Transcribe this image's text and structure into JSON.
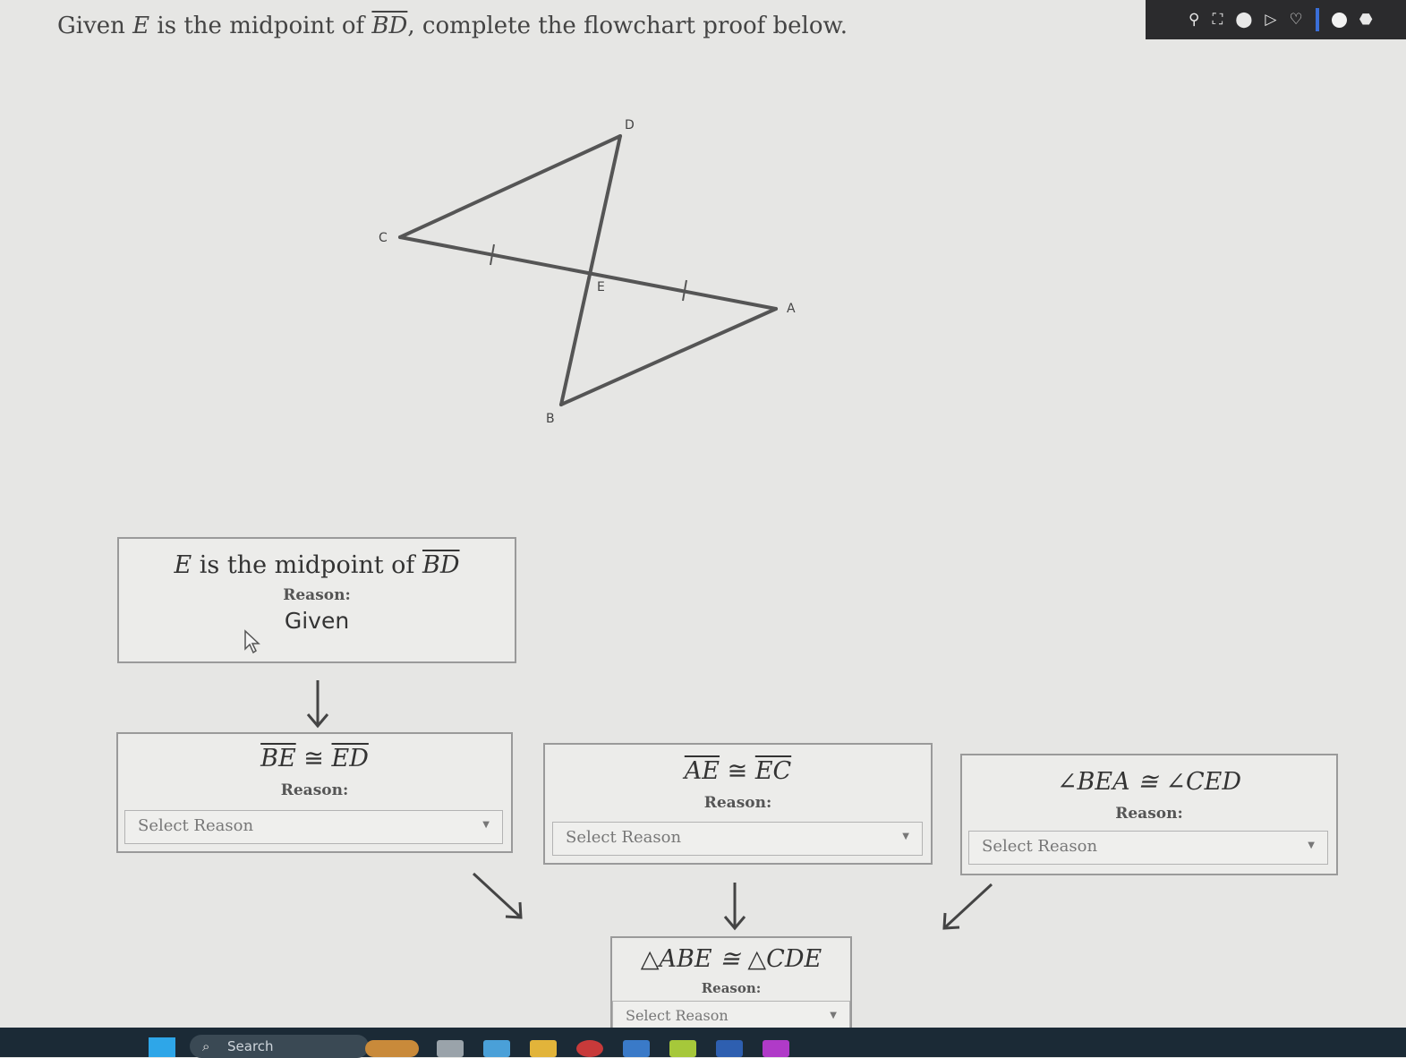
{
  "prompt": {
    "pre": "Given ",
    "var": "E",
    "mid": " is the midpoint of ",
    "seg": "BD",
    "post": ", complete the flowchart proof below."
  },
  "diagram_labels": {
    "D": "D",
    "C": "C",
    "E": "E",
    "A": "A",
    "B": "B"
  },
  "step1": {
    "var": "E",
    "text": " is the midpoint of ",
    "seg": "BD",
    "reason_label": "Reason:",
    "reason": "Given"
  },
  "step2": {
    "left": "BE",
    "cong": " ≅ ",
    "right": "ED",
    "reason_label": "Reason:",
    "select": "Select Reason"
  },
  "step3": {
    "left": "AE",
    "cong": " ≅ ",
    "right": "EC",
    "reason_label": "Reason:",
    "select": "Select Reason"
  },
  "step4": {
    "statement": "∠BEA ≅ ∠CED",
    "reason_label": "Reason:",
    "select": "Select Reason"
  },
  "step5": {
    "statement": "△ABE ≅ △CDE",
    "reason_label": "Reason:",
    "select": "Select Reason"
  },
  "taskbar": {
    "search_label": "Search"
  },
  "colors": {
    "accent_taskbar": "#1b2a36",
    "windows_logo": "#2ea6e8"
  }
}
